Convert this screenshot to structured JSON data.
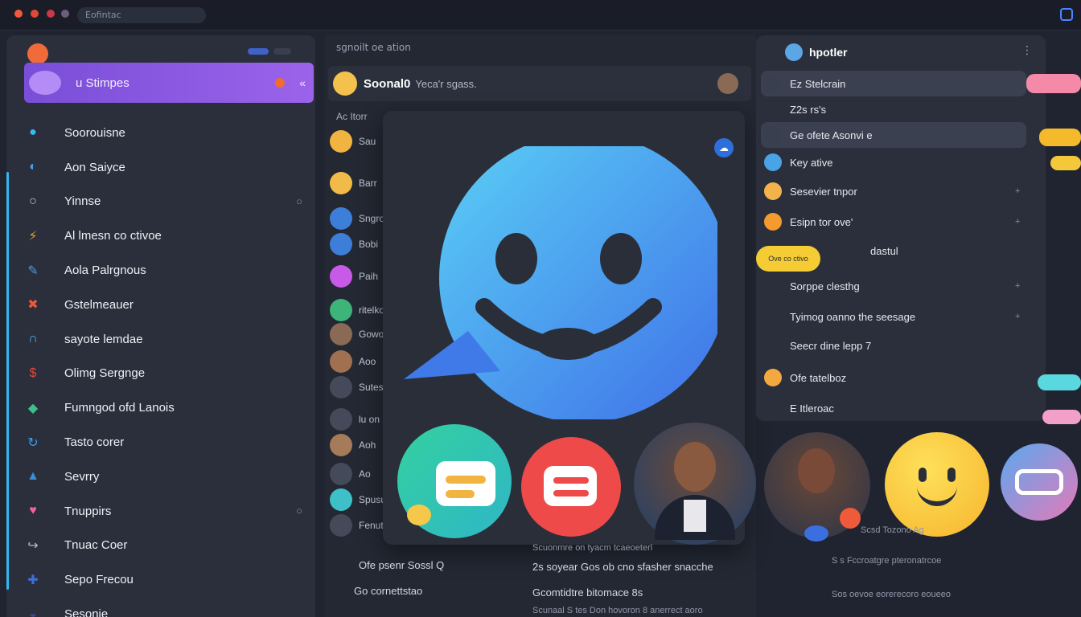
{
  "topbar": {
    "url_text": "Eofintac"
  },
  "sidebar": {
    "header_title": "u Stimpes",
    "items": [
      {
        "icon": "chat-bubble-icon",
        "label": "Soorouisne",
        "color": "#3bb8f2",
        "meta": ""
      },
      {
        "icon": "crescent-icon",
        "label": "Aon Saiyce",
        "color": "#4a9ee8",
        "meta": ""
      },
      {
        "icon": "search-icon",
        "label": "Yinnse",
        "color": "#c9cdd8",
        "meta": "○"
      },
      {
        "icon": "lightning-icon",
        "label": "Al lmesn co ctivoe",
        "color": "#f0a02e",
        "meta": ""
      },
      {
        "icon": "pin-icon",
        "label": "Aola Palrgnous",
        "color": "#4d9ad8",
        "meta": ""
      },
      {
        "icon": "tool-icon",
        "label": "Gstelmeauer",
        "color": "#f0573a",
        "meta": ""
      },
      {
        "icon": "headset-icon",
        "label": "sayote lemdae",
        "color": "#4db3f0",
        "meta": ""
      },
      {
        "icon": "dollar-icon",
        "label": "Olimg Sergnge",
        "color": "#e4453b",
        "meta": ""
      },
      {
        "icon": "leaf-icon",
        "label": "Fumngod ofd Lanois",
        "color": "#3ec08b",
        "meta": ""
      },
      {
        "icon": "refresh-icon",
        "label": "Tasto corer",
        "color": "#3aa0e8",
        "meta": ""
      },
      {
        "icon": "bird-icon",
        "label": "Sevrry",
        "color": "#3b8fd8",
        "meta": ""
      },
      {
        "icon": "heart-icon",
        "label": "Tnuppirs",
        "color": "#f0629b",
        "meta": "○"
      },
      {
        "icon": "arrow-icon",
        "label": "Tnuac Coer",
        "color": "#b7bcc9",
        "meta": ""
      },
      {
        "icon": "cross-icon",
        "label": "Sepo Frecou",
        "color": "#3e6fd8",
        "meta": ""
      },
      {
        "icon": "shell-icon",
        "label": "Sesonie",
        "color": "#3a4a8a",
        "meta": ""
      }
    ]
  },
  "mid": {
    "top_label": "sgnoilt oe ation",
    "header_name": "Soonal0",
    "header_sub": "Yeca'r sgass.",
    "section_label": "Ac Itorr",
    "rows": [
      {
        "label": "Sau",
        "color": "#f2b440"
      },
      {
        "label": "Barr",
        "color": "#f0bb48"
      },
      {
        "label": "Sngro",
        "color": "#3d7fd8"
      },
      {
        "label": "Bobi",
        "color": "#3d7fd8"
      },
      {
        "label": "Paih",
        "color": "#c85ae8"
      },
      {
        "label": "ritelkoh",
        "color": "#3cb47a"
      },
      {
        "label": "Gowo",
        "color": "#8a6a55"
      },
      {
        "label": "Aoo",
        "color": "#a07050"
      },
      {
        "label": "Sutesor",
        "color": "#444a5a"
      },
      {
        "label": "lu on",
        "color": "#444a5a"
      },
      {
        "label": "Aoh",
        "color": "#a67b5a"
      },
      {
        "label": "Ao",
        "color": "#444a5a"
      },
      {
        "label": "Spusuvo",
        "color": "#3ec0c8"
      },
      {
        "label": "Fenutaan Piit",
        "color": "#444a5a"
      }
    ]
  },
  "right": {
    "title": "hpotler",
    "rows": [
      {
        "label": "Ez Stelcrain",
        "icon_color": "#3a3f50",
        "bg": "#3b4050",
        "trail": ""
      },
      {
        "label": "Z2s rs's",
        "icon_color": "#2b2f3b",
        "bg": "",
        "trail": ""
      },
      {
        "label": "Ge ofete Asonvi e",
        "icon_color": "#3a3f50",
        "bg": "#3b4050",
        "trail": ""
      },
      {
        "label": "Key ative",
        "icon_color": "#4aa3e6",
        "bg": "",
        "trail": ""
      },
      {
        "label": "Sesevier tnpor",
        "icon_color": "#f3b34a",
        "bg": "",
        "trail": "+"
      },
      {
        "label": "Esipn tor ove'",
        "icon_color": "#f59a2e",
        "bg": "",
        "trail": "+"
      },
      {
        "label": "dastul",
        "icon_color": "",
        "bg": "",
        "trail": "+"
      },
      {
        "label": "Sorppe clesthg",
        "icon_color": "",
        "bg": "",
        "trail": "+"
      },
      {
        "label": "Tyimog oanno the seesage",
        "icon_color": "",
        "bg": "",
        "trail": "+"
      },
      {
        "label": "Seecr dine lepp 7",
        "icon_color": "",
        "bg": "",
        "trail": ""
      },
      {
        "label": "Ofe tatelboz",
        "icon_color": "#f3a940",
        "bg": "",
        "trail": ""
      },
      {
        "label": "E Itleroac",
        "icon_color": "",
        "bg": "",
        "trail": ""
      }
    ],
    "badge_label": "Ove co ctivo"
  },
  "card": {
    "badge_icon": "cloud-icon"
  },
  "bottom": {
    "left_rows": [
      "Ofe psenr Sossl Q",
      "Go cornettstao"
    ],
    "center_rows": [
      "Scuonmre  on tyacm tcaeoeterl",
      "2s soyear Gos ob cno sfasher snacche",
      "Gcomtidtre bitomace 8s",
      "Scunaal   S tes Don hovoron 8 anerrect aoro"
    ],
    "right_rows": [
      "Scsd Tozono Ag",
      "S s Fccroatgre pteronatrcoe",
      "Sos oevoe eorerecoro eoueeo"
    ]
  }
}
